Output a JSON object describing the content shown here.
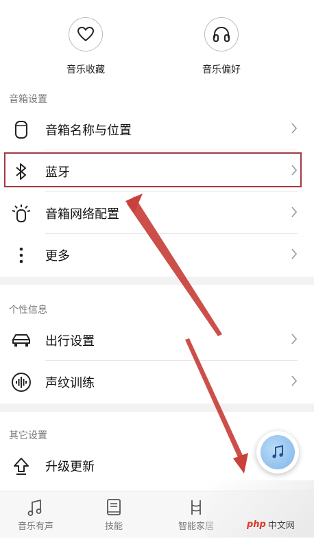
{
  "favorites": {
    "music_collection": "音乐收藏",
    "music_preference": "音乐偏好"
  },
  "sections": {
    "speaker": {
      "title": "音箱设置",
      "items": [
        {
          "label": "音箱名称与位置",
          "icon": "speaker-icon"
        },
        {
          "label": "蓝牙",
          "icon": "bluetooth-icon"
        },
        {
          "label": "音箱网络配置",
          "icon": "network-config-icon"
        },
        {
          "label": "更多",
          "icon": "more-vertical-icon"
        }
      ]
    },
    "personal": {
      "title": "个性信息",
      "items": [
        {
          "label": "出行设置",
          "icon": "car-icon"
        },
        {
          "label": "声纹训练",
          "icon": "voiceprint-icon"
        }
      ]
    },
    "other": {
      "title": "其它设置",
      "items": [
        {
          "label": "升级更新",
          "icon": "upgrade-icon"
        }
      ]
    }
  },
  "tabbar": {
    "tabs": [
      {
        "label": "音乐有声",
        "icon": "music-note-icon"
      },
      {
        "label": "技能",
        "icon": "book-icon"
      },
      {
        "label": "智能家居",
        "icon": "smart-home-icon"
      }
    ]
  },
  "watermark": {
    "brand": "php",
    "site": "中文网"
  },
  "colors": {
    "highlight_border": "#a33a43",
    "arrow": "#c8413a",
    "fab": "#8fc0ee"
  }
}
